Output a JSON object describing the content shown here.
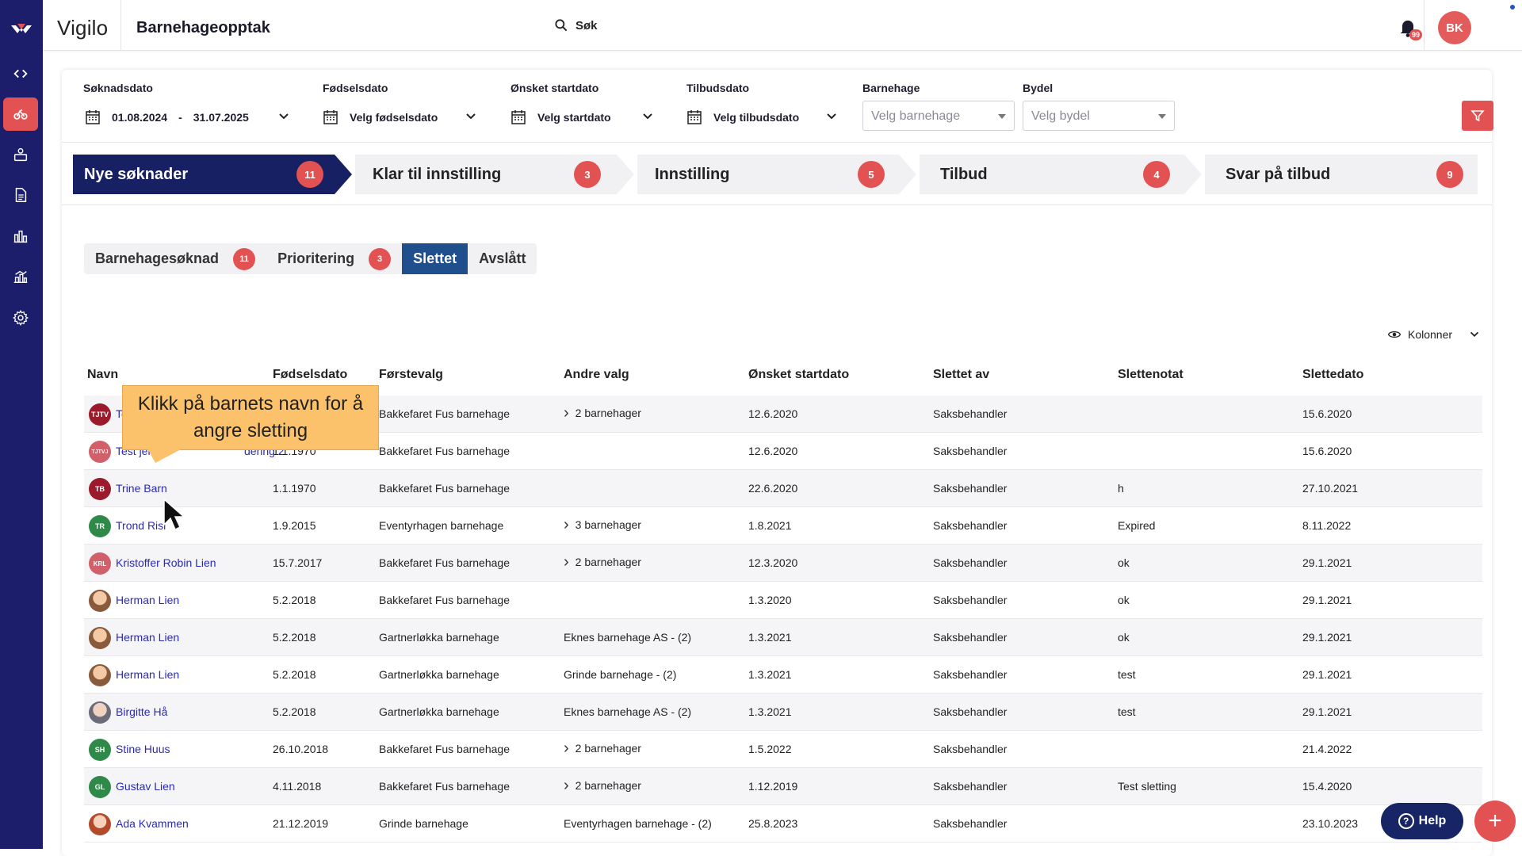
{
  "topbar": {
    "brand": "Vigilo",
    "title": "Barnehageopptak",
    "search_label": "Søk",
    "notification_count": "99",
    "user_initials": "BK"
  },
  "filters": {
    "soknadsdato": {
      "label": "Søknadsdato",
      "from": "01.08.2024",
      "sep": "-",
      "to": "31.07.2025"
    },
    "fodselsdato": {
      "label": "Fødselsdato",
      "value": "Velg fødselsdato"
    },
    "startdato": {
      "label": "Ønsket startdato",
      "value": "Velg startdato"
    },
    "tilbudsdato": {
      "label": "Tilbudsdato",
      "value": "Velg tilbudsdato"
    },
    "barnehage": {
      "label": "Barnehage",
      "placeholder": "Velg barnehage"
    },
    "bydel": {
      "label": "Bydel",
      "placeholder": "Velg bydel"
    }
  },
  "steps": [
    {
      "label": "Nye søknader",
      "count": "11"
    },
    {
      "label": "Klar til innstilling",
      "count": "3"
    },
    {
      "label": "Innstilling",
      "count": "5"
    },
    {
      "label": "Tilbud",
      "count": "4"
    },
    {
      "label": "Svar på tilbud",
      "count": "9"
    }
  ],
  "subtabs": [
    {
      "label": "Barnehagesøknad",
      "count": "11"
    },
    {
      "label": "Prioritering",
      "count": "3"
    },
    {
      "label": "Slettet"
    },
    {
      "label": "Avslått"
    }
  ],
  "columns_button": "Kolonner",
  "table": {
    "headers": [
      "Navn",
      "Fødselsdato",
      "Førstevalg",
      "Andre valg",
      "Ønsket startdato",
      "Slettet av",
      "Slettenotat",
      "Slettedato"
    ],
    "rows": [
      {
        "initials": "TJTV",
        "name": "Te",
        "birth": "",
        "first": "Bakkefaret Fus barnehage",
        "other": "2 barnehager",
        "start": "12.6.2020",
        "by": "Saksbehandler",
        "note": "",
        "deleted": "15.6.2020"
      },
      {
        "initials": "TJTVJ",
        "name": "Test jente",
        "name_tail": "dering 2",
        "birth": "1.1.1970",
        "first": "Bakkefaret Fus barnehage",
        "other": "",
        "start": "12.6.2020",
        "by": "Saksbehandler",
        "note": "",
        "deleted": "15.6.2020"
      },
      {
        "initials": "TB",
        "name": "Trine Barn",
        "birth": "1.1.1970",
        "first": "Bakkefaret Fus barnehage",
        "other": "",
        "start": "22.6.2020",
        "by": "Saksbehandler",
        "note": "h",
        "deleted": "27.10.2021"
      },
      {
        "initials": "TR",
        "name": "Trond Risl",
        "birth": "1.9.2015",
        "first": "Eventyrhagen barnehage",
        "other": "3 barnehager",
        "start": "1.8.2021",
        "by": "Saksbehandler",
        "note": "Expired",
        "deleted": "8.11.2022"
      },
      {
        "initials": "KRL",
        "name": "Kristoffer Robin Lien",
        "birth": "15.7.2017",
        "first": "Bakkefaret Fus barnehage",
        "other": "2 barnehager",
        "start": "12.3.2020",
        "by": "Saksbehandler",
        "note": "ok",
        "deleted": "29.1.2021"
      },
      {
        "initials": "",
        "name": "Herman Lien",
        "birth": "5.2.2018",
        "first": "Bakkefaret Fus barnehage",
        "other": "",
        "start": "1.3.2020",
        "by": "Saksbehandler",
        "note": "ok",
        "deleted": "29.1.2021"
      },
      {
        "initials": "",
        "name": "Herman Lien",
        "birth": "5.2.2018",
        "first": "Gartnerløkka barnehage",
        "other": "Eknes barnehage AS - (2)",
        "start": "1.3.2021",
        "by": "Saksbehandler",
        "note": "ok",
        "deleted": "29.1.2021"
      },
      {
        "initials": "",
        "name": "Herman Lien",
        "birth": "5.2.2018",
        "first": "Gartnerløkka barnehage",
        "other": "Grinde barnehage - (2)",
        "start": "1.3.2021",
        "by": "Saksbehandler",
        "note": "test",
        "deleted": "29.1.2021"
      },
      {
        "initials": "",
        "name": "Birgitte Hå",
        "birth": "5.2.2018",
        "first": "Gartnerløkka barnehage",
        "other": "Eknes barnehage AS - (2)",
        "start": "1.3.2021",
        "by": "Saksbehandler",
        "note": "test",
        "deleted": "29.1.2021"
      },
      {
        "initials": "SH",
        "name": "Stine Huus",
        "birth": "26.10.2018",
        "first": "Bakkefaret Fus barnehage",
        "other": "2 barnehager",
        "start": "1.5.2022",
        "by": "Saksbehandler",
        "note": "",
        "deleted": "21.4.2022"
      },
      {
        "initials": "GL",
        "name": "Gustav Lien",
        "birth": "4.11.2018",
        "first": "Bakkefaret Fus barnehage",
        "other": "2 barnehager",
        "start": "1.12.2019",
        "by": "Saksbehandler",
        "note": "Test sletting",
        "deleted": "15.4.2020"
      },
      {
        "initials": "",
        "name": "Ada Kvammen",
        "birth": "21.12.2019",
        "first": "Grinde barnehage",
        "other": "Eventyrhagen barnehage - (2)",
        "start": "25.8.2023",
        "by": "Saksbehandler",
        "note": "",
        "deleted": "23.10.2023"
      }
    ]
  },
  "tooltip": {
    "line1": "Klikk på barnets navn for å",
    "line2": "angre sletting"
  },
  "help_label": "Help",
  "fab_label": "+",
  "colors": {
    "rail": "#1c1e6c",
    "accent": "#e35252",
    "step_active": "#162062",
    "tab_active": "#1f4f8d",
    "link": "#2a2ab8",
    "tooltip": "#fbc26b"
  }
}
